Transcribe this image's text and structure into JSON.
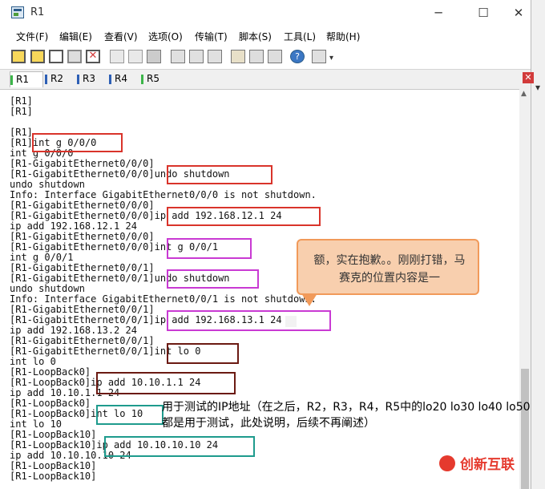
{
  "window": {
    "title": "R1"
  },
  "menu": [
    "文件(F)",
    "编辑(E)",
    "查看(V)",
    "选项(O)",
    "传输(T)",
    "脚本(S)",
    "工具(L)",
    "帮助(H)"
  ],
  "tabs": [
    "R1",
    "R2",
    "R3",
    "R4",
    "R5"
  ],
  "terminal_lines": [
    "[R1]",
    "[R1]",
    "",
    "[R1]",
    "[R1]int g 0/0/0",
    "int g 0/0/0",
    "[R1-GigabitEthernet0/0/0]",
    "[R1-GigabitEthernet0/0/0]undo shutdown",
    "undo shutdown",
    "Info: Interface GigabitEthernet0/0/0 is not shutdown.",
    "[R1-GigabitEthernet0/0/0]",
    "[R1-GigabitEthernet0/0/0]ip add 192.168.12.1 24",
    "ip add 192.168.12.1 24",
    "[R1-GigabitEthernet0/0/0]",
    "[R1-GigabitEthernet0/0/0]int g 0/0/1",
    "int g 0/0/1",
    "[R1-GigabitEthernet0/0/1]",
    "[R1-GigabitEthernet0/0/1]undo shutdown",
    "undo shutdown",
    "Info: Interface GigabitEthernet0/0/1 is not shutdown.",
    "[R1-GigabitEthernet0/0/1]",
    "[R1-GigabitEthernet0/0/1]ip add 192.168.13.1 24",
    "ip add 192.168.13.2 24",
    "[R1-GigabitEthernet0/0/1]",
    "[R1-GigabitEthernet0/0/1]int lo 0",
    "int lo 0",
    "[R1-LoopBack0]",
    "[R1-LoopBack0]ip add 10.10.1.1 24",
    "ip add 10.10.1.1 24",
    "[R1-LoopBack0]",
    "[R1-LoopBack0]int lo 10",
    "int lo 10",
    "[R1-LoopBack10]",
    "[R1-LoopBack10]ip add 10.10.10.10 24",
    "ip add 10.10.10.10 24",
    "[R1-LoopBack10]",
    "[R1-LoopBack10]"
  ],
  "callout": {
    "text": "额，实在抱歉。。刚刚打错，马赛克的位置内容是一"
  },
  "note": {
    "text": "用于测试的IP地址（在之后，R2，R3，R4，R5中的lo20 lo30 lo40 lo50都是用于测试，此处说明，后续不再阐述）"
  },
  "watermark": {
    "text": "创新互联"
  },
  "colors": {
    "red": "#d9342b",
    "magenta": "#c93ad3",
    "brown": "#6b1a12",
    "teal": "#1e9b8d",
    "callout_fill": "#f8cfae",
    "callout_border": "#f19a5a"
  }
}
